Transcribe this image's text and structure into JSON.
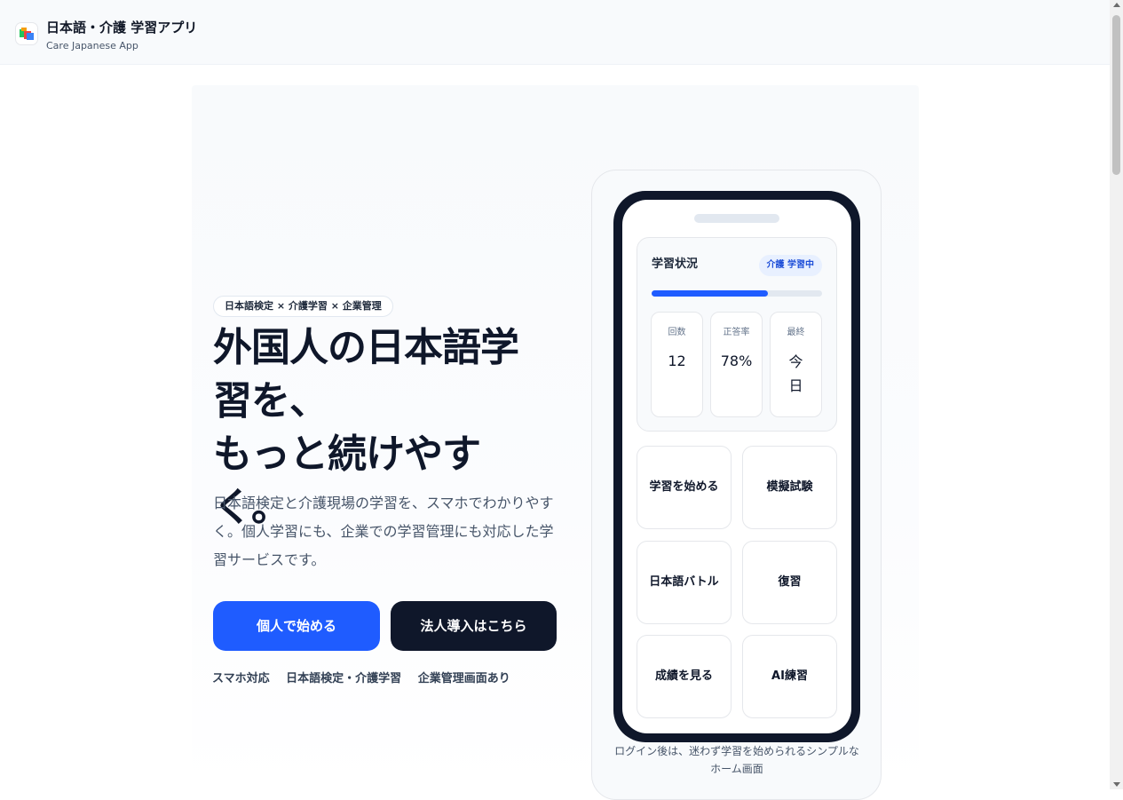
{
  "header": {
    "title": "日本語・介護 学習アプリ",
    "subtitle": "Care Japanese App",
    "logo_icon": "app-logo-icon"
  },
  "hero": {
    "chip": "日本語検定 × 介護学習 × 企業管理",
    "headline": [
      "外国人の日本語学",
      "習を、",
      "もっと続けやすく。"
    ],
    "description": "日本語検定と介護現場の学習を、スマホでわかりやすく。個人学習にも、企業での学習管理にも対応した学習サービスです。",
    "primary_button": "個人で始める",
    "secondary_button": "法人導入はこちら",
    "features": [
      "スマホ対応",
      "日本語検定・介護学習",
      "企業管理画面あり"
    ]
  },
  "phone": {
    "status": {
      "title": "学習状況",
      "badge": "介護 学習中",
      "progress": 0.68,
      "stats": [
        {
          "label": "回数",
          "value": "12"
        },
        {
          "label": "正答率",
          "value": "78%"
        },
        {
          "label": "最終",
          "value": "今日"
        }
      ]
    },
    "menu": [
      "学習を始める",
      "模擬試験",
      "日本語バトル",
      "復習",
      "成績を見る",
      "AI練習"
    ],
    "caption": "ログイン後は、迷わず学習を始められるシンプルなホーム画面"
  },
  "colors": {
    "primary": "#1f5cff",
    "dark": "#0f172a",
    "badge_bg": "#e8f0ff",
    "badge_text": "#1d4ed8"
  }
}
